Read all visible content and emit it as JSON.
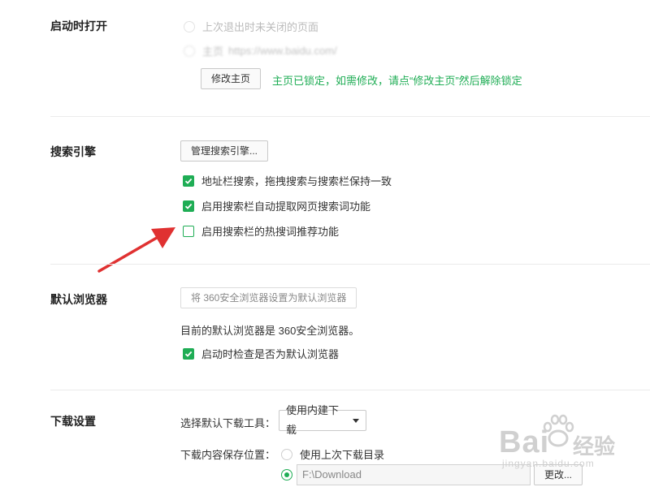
{
  "startup": {
    "title": "启动时打开",
    "option_restore": "上次退出时未关闭的页面",
    "option_homepage": "主页",
    "homepage_url": "https://www.baidu.com/",
    "modify_button": "修改主页",
    "locked_note": "主页已锁定，如需修改，请点“修改主页”然后解除锁定"
  },
  "search": {
    "title": "搜索引擎",
    "manage_button": "管理搜索引擎...",
    "options": [
      {
        "label": "地址栏搜索，拖拽搜索与搜索栏保持一致",
        "checked": true
      },
      {
        "label": "启用搜索栏自动提取网页搜索词功能",
        "checked": true
      },
      {
        "label": "启用搜索栏的热搜词推荐功能",
        "checked": false
      }
    ]
  },
  "default_browser": {
    "title": "默认浏览器",
    "set_default_button": "将 360安全浏览器设置为默认浏览器",
    "status_text": "目前的默认浏览器是 360安全浏览器。",
    "check_on_startup": {
      "label": "启动时检查是否为默认浏览器",
      "checked": true
    }
  },
  "download": {
    "title": "下载设置",
    "tool_label": "选择默认下载工具：",
    "tool_selected": "使用内建下载",
    "location_label": "下载内容保存位置：",
    "option_last_dir": "使用上次下载目录",
    "path_value": "F:\\Download",
    "change_button": "更改..."
  },
  "watermark": {
    "brand": "Bai",
    "brand2": "经验",
    "url": "jingyan.baidu.com"
  },
  "colors": {
    "accent_green": "#1fad55",
    "arrow_red": "#e03131"
  },
  "icons": {
    "checkbox": "check-icon",
    "arrow": "red-arrow-icon",
    "dropdown": "chevron-down-icon",
    "watermark": "paw-icon"
  }
}
